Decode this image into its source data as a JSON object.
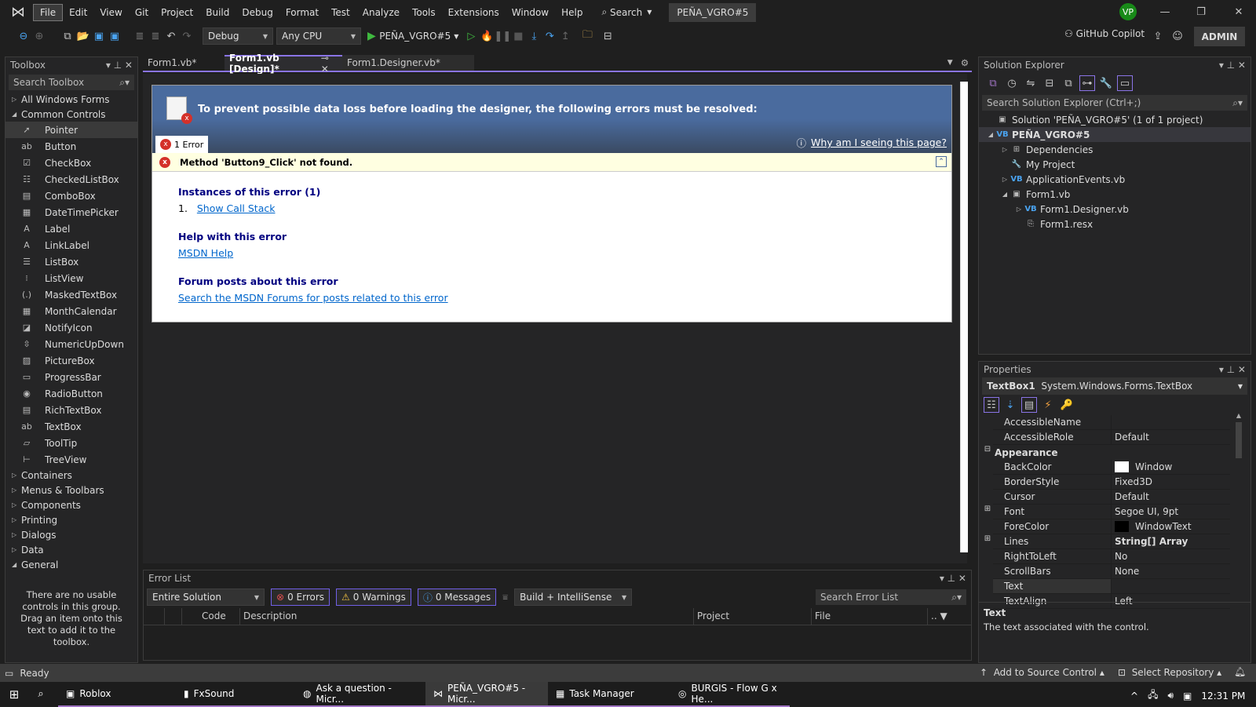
{
  "menubar": {
    "items": [
      "File",
      "Edit",
      "View",
      "Git",
      "Project",
      "Build",
      "Debug",
      "Format",
      "Test",
      "Analyze",
      "Tools",
      "Extensions",
      "Window",
      "Help"
    ],
    "search": "Search",
    "solution_name": "PEÑA_VGRO#5",
    "avatar": "VP"
  },
  "toolbar": {
    "config": "Debug",
    "platform": "Any CPU",
    "start": "PEÑA_VGRO#5",
    "copilot": "GitHub Copilot",
    "admin": "ADMIN"
  },
  "toolbox": {
    "title": "Toolbox",
    "search_placeholder": "Search Toolbox",
    "all_forms": "All Windows Forms",
    "common": "Common Controls",
    "items": [
      {
        "label": "Pointer",
        "icon": "➚"
      },
      {
        "label": "Button",
        "icon": "ab"
      },
      {
        "label": "CheckBox",
        "icon": "☑"
      },
      {
        "label": "CheckedListBox",
        "icon": "☷"
      },
      {
        "label": "ComboBox",
        "icon": "▤"
      },
      {
        "label": "DateTimePicker",
        "icon": "▦"
      },
      {
        "label": "Label",
        "icon": "A"
      },
      {
        "label": "LinkLabel",
        "icon": "A"
      },
      {
        "label": "ListBox",
        "icon": "☰"
      },
      {
        "label": "ListView",
        "icon": "⁝"
      },
      {
        "label": "MaskedTextBox",
        "icon": "(.)"
      },
      {
        "label": "MonthCalendar",
        "icon": "▦"
      },
      {
        "label": "NotifyIcon",
        "icon": "◪"
      },
      {
        "label": "NumericUpDown",
        "icon": "⇳"
      },
      {
        "label": "PictureBox",
        "icon": "▨"
      },
      {
        "label": "ProgressBar",
        "icon": "▭"
      },
      {
        "label": "RadioButton",
        "icon": "◉"
      },
      {
        "label": "RichTextBox",
        "icon": "▤"
      },
      {
        "label": "TextBox",
        "icon": "ab"
      },
      {
        "label": "ToolTip",
        "icon": "▱"
      },
      {
        "label": "TreeView",
        "icon": "⊢"
      }
    ],
    "groups": [
      "Containers",
      "Menus & Toolbars",
      "Components",
      "Printing",
      "Dialogs",
      "Data"
    ],
    "general": "General",
    "empty_text": "There are no usable controls in this group. Drag an item onto this text to add it to the toolbox."
  },
  "tabs": [
    {
      "label": "Form1.vb*"
    },
    {
      "label": "Form1.vb [Design]*"
    },
    {
      "label": "Form1.Designer.vb*"
    }
  ],
  "designer": {
    "banner": "To prevent possible data loss before loading the designer, the following errors must be resolved:",
    "error_tab": "1 Error",
    "why_link": "Why am I seeing this page?",
    "error_message": "Method 'Button9_Click' not found.",
    "instances_heading": "Instances of this error (1)",
    "instance_num": "1.",
    "call_stack": "Show Call Stack",
    "help_heading": "Help with this error",
    "msdn_help": "MSDN Help",
    "forum_heading": "Forum posts about this error",
    "forum_link": "Search the MSDN Forums for posts related to this error"
  },
  "error_list": {
    "title": "Error List",
    "scope": "Entire Solution",
    "errors": "0 Errors",
    "warnings": "0 Warnings",
    "messages": "0 Messages",
    "build_filter": "Build + IntelliSense",
    "search_placeholder": "Search Error List",
    "columns": [
      "Code",
      "Description",
      "Project",
      "File",
      ".."
    ]
  },
  "solution_explorer": {
    "title": "Solution Explorer",
    "search_placeholder": "Search Solution Explorer (Ctrl+;)",
    "items": [
      {
        "label": "Solution 'PEÑA_VGRO#5' (1 of 1 project)",
        "depth": 0,
        "tri": "",
        "icon": "▣"
      },
      {
        "label": "PEÑA_VGRO#5",
        "depth": 0,
        "tri": "◢",
        "icon": "VB",
        "bold": true
      },
      {
        "label": "Dependencies",
        "depth": 1,
        "tri": "▷",
        "icon": "⊞"
      },
      {
        "label": "My Project",
        "depth": 1,
        "tri": "",
        "icon": "🔧"
      },
      {
        "label": "ApplicationEvents.vb",
        "depth": 1,
        "tri": "▷",
        "icon": "VB"
      },
      {
        "label": "Form1.vb",
        "depth": 1,
        "tri": "◢",
        "icon": "▣"
      },
      {
        "label": "Form1.Designer.vb",
        "depth": 2,
        "tri": "▷",
        "icon": "VB"
      },
      {
        "label": "Form1.resx",
        "depth": 2,
        "tri": "",
        "icon": "⎘"
      }
    ]
  },
  "properties": {
    "title": "Properties",
    "object": "TextBox1",
    "type": "System.Windows.Forms.TextBox",
    "rows": [
      {
        "name": "AccessibleName",
        "value": ""
      },
      {
        "name": "AccessibleRole",
        "value": "Default"
      },
      {
        "name": "Appearance",
        "category": true
      },
      {
        "name": "BackColor",
        "value": "Window",
        "swatch": "#ffffff"
      },
      {
        "name": "BorderStyle",
        "value": "Fixed3D"
      },
      {
        "name": "Cursor",
        "value": "Default"
      },
      {
        "name": "Font",
        "value": "Segoe UI, 9pt",
        "expand": true
      },
      {
        "name": "ForeColor",
        "value": "WindowText",
        "swatch": "#000000"
      },
      {
        "name": "Lines",
        "value": "String[] Array",
        "expand": true,
        "bold": true
      },
      {
        "name": "RightToLeft",
        "value": "No"
      },
      {
        "name": "ScrollBars",
        "value": "None"
      },
      {
        "name": "Text",
        "value": "",
        "selected": true
      },
      {
        "name": "TextAlign",
        "value": "Left"
      }
    ],
    "desc_title": "Text",
    "desc_text": "The text associated with the control."
  },
  "statusbar": {
    "status": "Ready",
    "source_control": "Add to Source Control",
    "repository": "Select Repository"
  },
  "taskbar": {
    "apps": [
      "Roblox",
      "FxSound",
      "Ask a question - Micr...",
      "PEÑA_VGRO#5 - Micr...",
      "Task Manager",
      "BURGIS - Flow G x He..."
    ],
    "time": "12:31 PM"
  },
  "colors": {
    "accent": "#8a74e6",
    "banner": "#4a6b9e",
    "error_bar": "#ffffe1",
    "link": "#0066cc",
    "heading": "#000080"
  }
}
